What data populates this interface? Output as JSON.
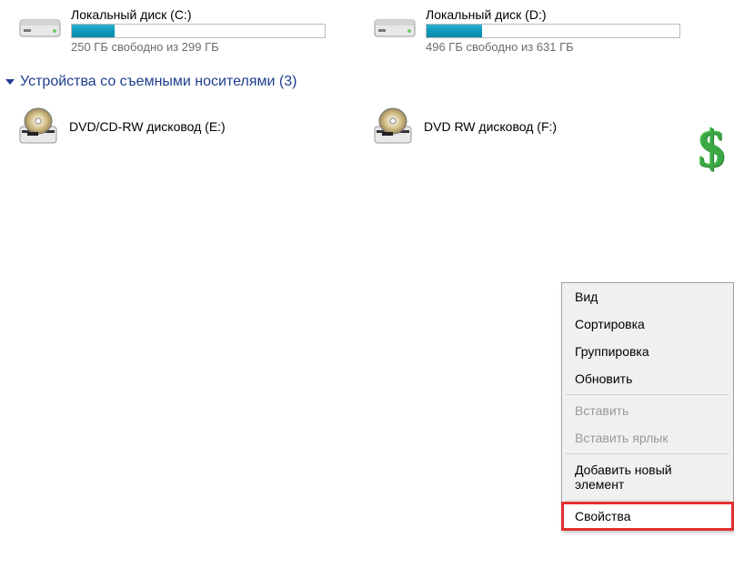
{
  "drives": [
    {
      "name": "Локальный диск (C:)",
      "space": "250 ГБ свободно из 299 ГБ",
      "fill_percent": 17
    },
    {
      "name": "Локальный диск (D:)",
      "space": "496 ГБ свободно из 631 ГБ",
      "fill_percent": 22
    }
  ],
  "removable_section": {
    "title": "Устройства со съемными носителями (3)"
  },
  "optical": [
    {
      "name": "DVD/CD-RW дисковод (E:)"
    },
    {
      "name": "DVD RW дисковод (F:)"
    }
  ],
  "money_glyph": "$",
  "context_menu": {
    "items": [
      {
        "label": "Вид",
        "enabled": true
      },
      {
        "label": "Сортировка",
        "enabled": true
      },
      {
        "label": "Группировка",
        "enabled": true
      },
      {
        "label": "Обновить",
        "enabled": true
      },
      {
        "sep": true
      },
      {
        "label": "Вставить",
        "enabled": false
      },
      {
        "label": "Вставить ярлык",
        "enabled": false
      },
      {
        "sep": true
      },
      {
        "label": "Добавить новый элемент",
        "enabled": true
      },
      {
        "sep": true
      },
      {
        "label": "Свойства",
        "enabled": true,
        "highlighted": true
      }
    ]
  }
}
